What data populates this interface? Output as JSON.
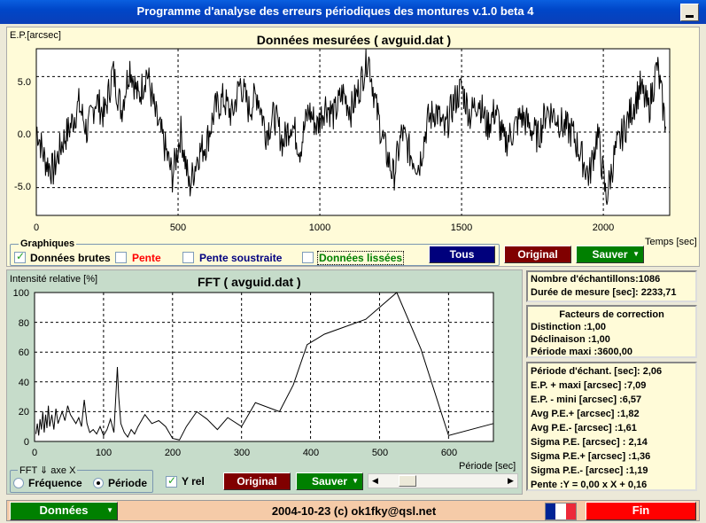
{
  "window": {
    "title": "Programme d'analyse des erreurs périodiques des montures v.1.0 beta 4"
  },
  "top_chart": {
    "title": "Données mesurées ( avguid.dat )",
    "ylabel": "E.P.[arcsec]",
    "xlabel": "Temps [sec]",
    "y_ticks": [
      "5.0",
      "0.0",
      "-5.0"
    ],
    "x_ticks": [
      "0",
      "500",
      "1000",
      "1500",
      "2000"
    ]
  },
  "graphiques": {
    "label": "Graphiques",
    "donnees_brutes": "Données brutes",
    "pente": "Pente",
    "pente_soustraite": "Pente soustraite",
    "donnees_lissees": "Données lissées",
    "colors": {
      "pente": "#ff0000",
      "pente_soustraite": "#000080",
      "donnees_lissees": "#008000"
    }
  },
  "top_buttons": {
    "tous": "Tous",
    "original": "Original",
    "sauver": "Sauver"
  },
  "fft_chart": {
    "title": "FFT ( avguid.dat )",
    "ylabel": "Intensité relative [%]",
    "xlabel": "Période [sec]",
    "y_ticks": [
      "100",
      "80",
      "60",
      "40",
      "20",
      "0"
    ],
    "x_ticks": [
      "0",
      "100",
      "200",
      "300",
      "400",
      "500",
      "600"
    ]
  },
  "fft_axis": {
    "label": "FFT ⇓ axe X",
    "frequence": "Fréquence",
    "periode": "Période",
    "yrel": "Y rel"
  },
  "bottom_buttons": {
    "original": "Original",
    "sauver": "Sauver"
  },
  "info": {
    "nb_echantillons": "Nombre d'échantillons:1086",
    "duree": "Durée de mesure [sec]: 2233,71"
  },
  "correction": {
    "title": "Facteurs de correction",
    "distinction": "Distinction :1,00",
    "declinaison": "Déclinaison :1,00",
    "periode_maxi": "Période maxi :3600,00"
  },
  "stats": [
    "Période d'échant. [sec]: 2,06",
    "E.P. + maxi [arcsec] :7,09",
    "E.P. - mini [arcsec] :6,57",
    "Avg P.E.+ [arcsec] :1,82",
    "Avg P.E.- [arcsec] :1,61",
    "Sigma P.E. [arcsec] : 2,14",
    "Sigma P.E.+ [arcsec] :1,36",
    "Sigma P.E.- [arcsec] :1,19",
    "Pente :Y = 0,00 x X + 0,16"
  ],
  "footer": {
    "donnees": "Données",
    "copyright": "2004-10-23 (c) ok1fky@qsl.net",
    "fin": "Fin"
  },
  "flag_colors": [
    "#002395",
    "#ffffff",
    "#ed2939"
  ],
  "chart_data": [
    {
      "type": "line",
      "title": "Données mesurées ( avguid.dat )",
      "xlabel": "Temps [sec]",
      "ylabel": "E.P.[arcsec]",
      "xlim": [
        0,
        2234
      ],
      "ylim": [
        -7.5,
        7.5
      ],
      "grid": true,
      "x": [
        0,
        30,
        60,
        90,
        120,
        150,
        180,
        210,
        240,
        270,
        300,
        330,
        360,
        390,
        420,
        450,
        480,
        510,
        540,
        570,
        600,
        630,
        660,
        690,
        720,
        750,
        780,
        810,
        840,
        870,
        900,
        930,
        960,
        990,
        1020,
        1050,
        1080,
        1110,
        1140,
        1170,
        1200,
        1230,
        1260,
        1290,
        1320,
        1350,
        1380,
        1410,
        1440,
        1470,
        1500,
        1530,
        1560,
        1590,
        1620,
        1650,
        1680,
        1710,
        1740,
        1770,
        1800,
        1830,
        1860,
        1890,
        1920,
        1950,
        1980,
        2010,
        2040,
        2070,
        2100,
        2130,
        2160,
        2190,
        2220
      ],
      "values": [
        0.5,
        -2.5,
        -3.5,
        -1,
        0.5,
        2.5,
        0,
        3,
        1.5,
        5.5,
        2,
        6,
        3,
        5.5,
        1.5,
        -1,
        -4,
        0,
        -5,
        -2,
        -1,
        2,
        3,
        1.5,
        4.5,
        2,
        3.5,
        0,
        1.5,
        -1,
        1,
        -1.5,
        2,
        0.5,
        2.5,
        1.5,
        3.5,
        2,
        4,
        7,
        2,
        -1.5,
        -4,
        0,
        -2,
        -3,
        1,
        2,
        0,
        2.5,
        4,
        1.5,
        3,
        0.5,
        2,
        -1,
        0,
        1.5,
        0.5,
        -0.5,
        2,
        1.5,
        0.5,
        0,
        -2,
        -4,
        0,
        -6,
        -2,
        0,
        2,
        4,
        2,
        6,
        0.5
      ]
    },
    {
      "type": "line",
      "title": "FFT ( avguid.dat )",
      "xlabel": "Période [sec]",
      "ylabel": "Intensité relative [%]",
      "xlim": [
        0,
        665
      ],
      "ylim": [
        0,
        100
      ],
      "grid": true,
      "x": [
        2,
        4,
        6,
        8,
        10,
        12,
        14,
        16,
        18,
        20,
        22,
        25,
        28,
        31,
        34,
        37,
        40,
        44,
        48,
        52,
        56,
        60,
        64,
        68,
        72,
        76,
        80,
        85,
        90,
        95,
        100,
        105,
        110,
        115,
        120,
        122,
        125,
        130,
        135,
        140,
        145,
        150,
        160,
        170,
        180,
        190,
        200,
        210,
        220,
        235,
        250,
        265,
        280,
        300,
        320,
        355,
        375,
        395,
        420,
        480,
        525,
        560,
        600,
        665
      ],
      "values": [
        5,
        12,
        4,
        15,
        8,
        20,
        6,
        18,
        9,
        24,
        10,
        18,
        8,
        22,
        12,
        16,
        20,
        14,
        24,
        18,
        15,
        12,
        16,
        10,
        28,
        12,
        6,
        8,
        5,
        10,
        4,
        8,
        15,
        6,
        50,
        30,
        12,
        6,
        3,
        8,
        5,
        10,
        18,
        12,
        14,
        10,
        2,
        1,
        10,
        20,
        15,
        8,
        16,
        10,
        26,
        20,
        38,
        65,
        72,
        82,
        100,
        62,
        4,
        12
      ]
    }
  ]
}
